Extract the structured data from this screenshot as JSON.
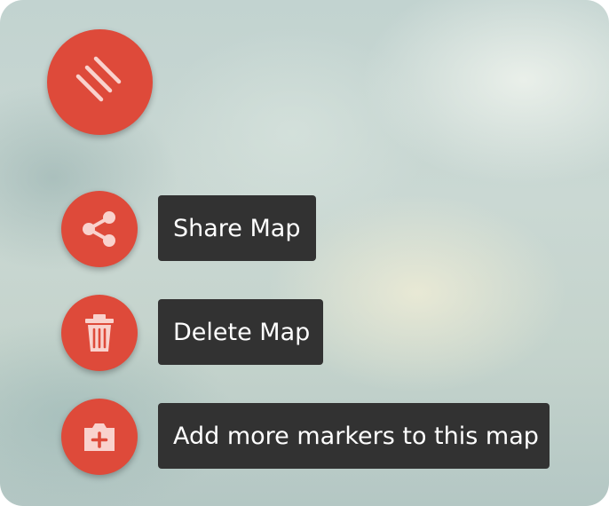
{
  "menu": {
    "main_button_icon": "menu-lines-icon",
    "items": [
      {
        "label": "Share Map",
        "icon": "share-icon"
      },
      {
        "label": "Delete Map",
        "icon": "trash-icon"
      },
      {
        "label": "Add more markers to this map",
        "icon": "add-marker-icon"
      }
    ]
  },
  "colors": {
    "fab_red": "#de4a3a",
    "icon_pink": "#f9d2cd",
    "tooltip_bg": "#323232",
    "tooltip_text": "#ffffff"
  }
}
